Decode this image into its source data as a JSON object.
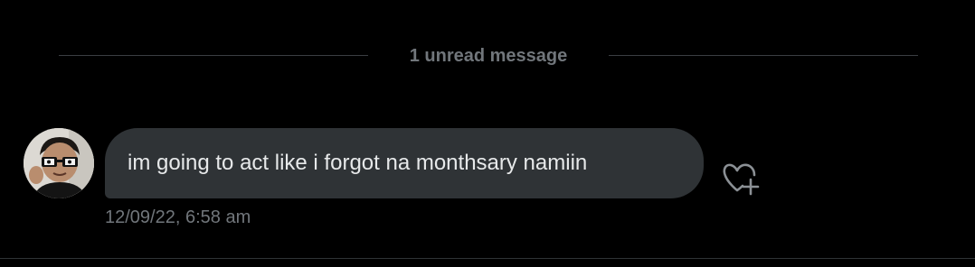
{
  "divider": {
    "label": "1 unread message"
  },
  "message": {
    "text": "im going to act like i forgot na monthsary namiin",
    "timestamp": "12/09/22, 6:58 am"
  },
  "icons": {
    "react": "heart-plus-icon",
    "avatar": "user-avatar"
  },
  "colors": {
    "background": "#000000",
    "bubble": "#2f3336",
    "text": "#e7e9ea",
    "muted": "#71767b",
    "divider_line": "#3a3e42"
  }
}
